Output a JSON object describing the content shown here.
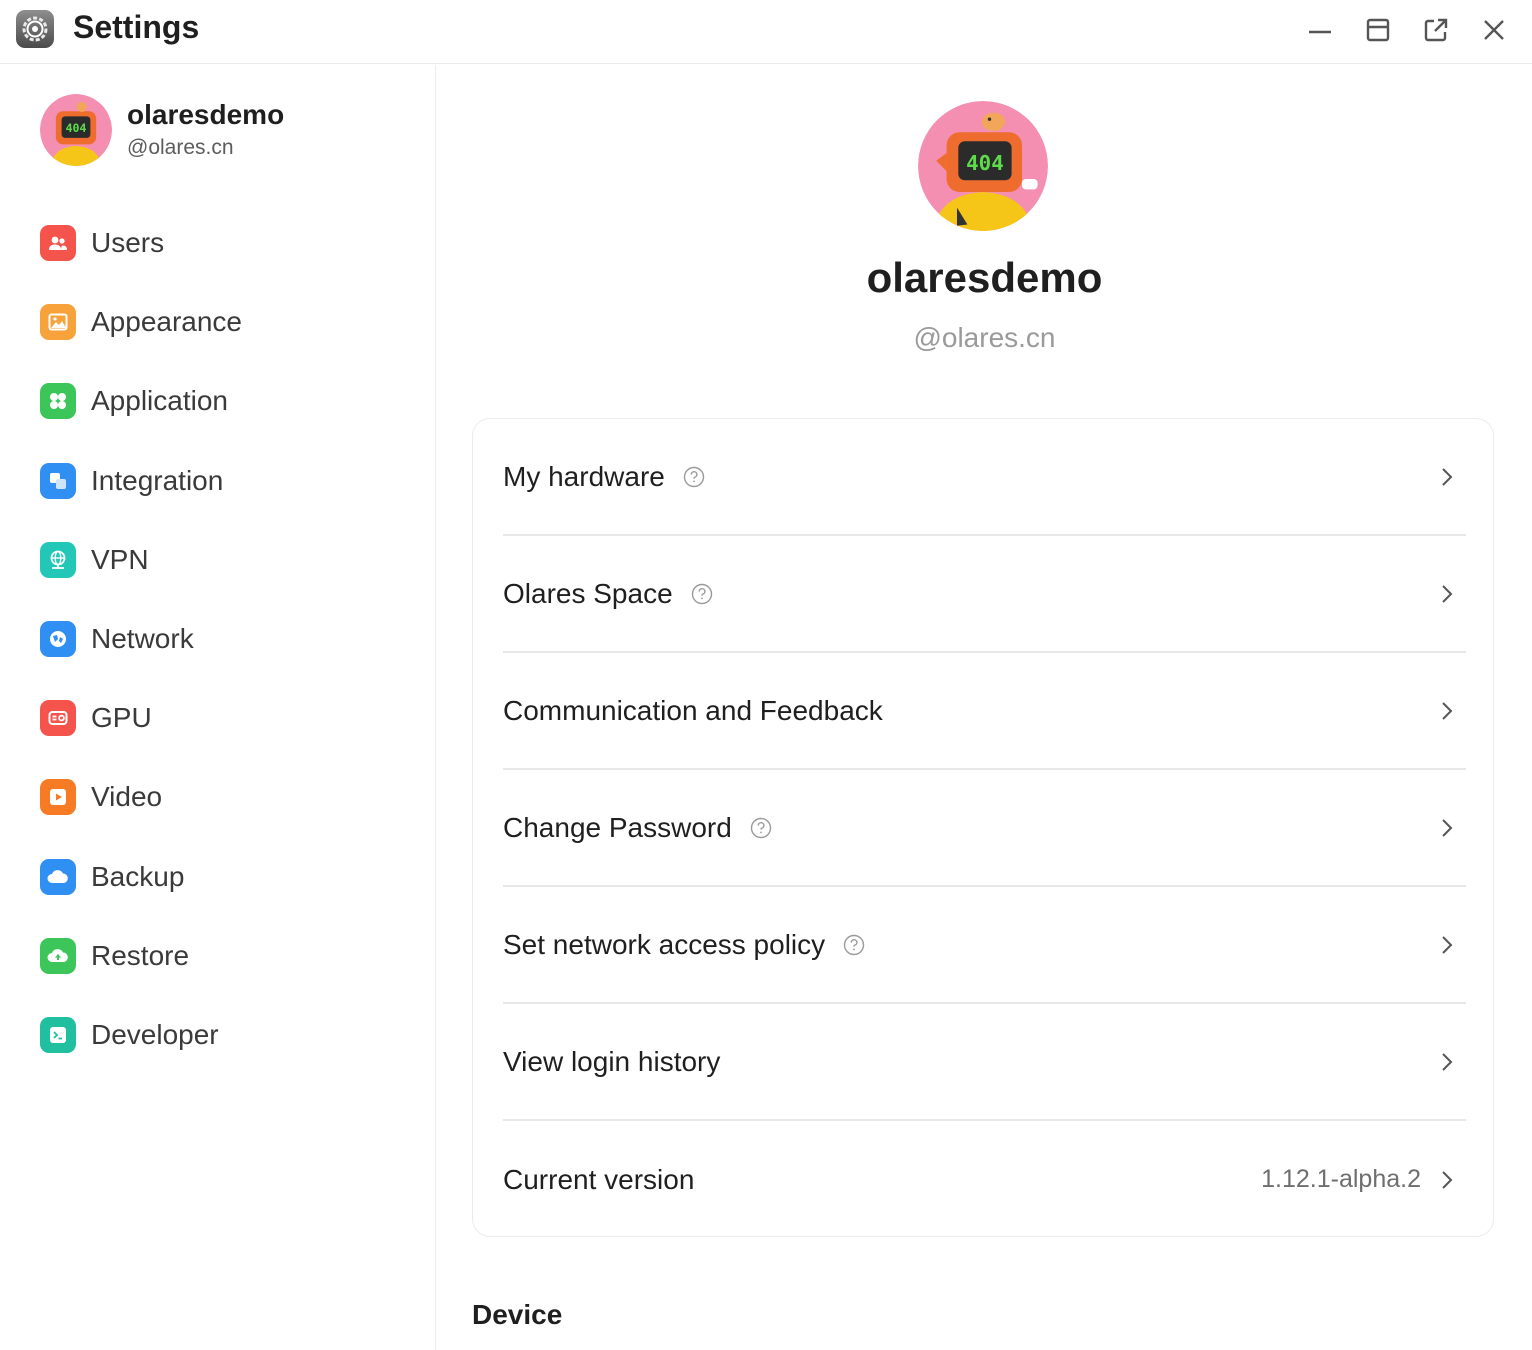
{
  "window": {
    "title": "Settings",
    "icons": [
      "settings-gear-icon",
      "minimize-icon",
      "maximize-icon",
      "open-external-icon",
      "close-icon"
    ]
  },
  "user": {
    "name": "olaresdemo",
    "domain": "@olares.cn",
    "avatar_text": "404"
  },
  "sidebar": {
    "items": [
      {
        "label": "Users",
        "icon": "users-icon",
        "color": "#f5544d"
      },
      {
        "label": "Appearance",
        "icon": "image-icon",
        "color": "#f7a23b"
      },
      {
        "label": "Application",
        "icon": "apps-icon",
        "color": "#3cc65a"
      },
      {
        "label": "Integration",
        "icon": "integration-icon",
        "color": "#2f8ff3"
      },
      {
        "label": "VPN",
        "icon": "globe-icon",
        "color": "#22c7b8"
      },
      {
        "label": "Network",
        "icon": "network-icon",
        "color": "#2f8ff3"
      },
      {
        "label": "GPU",
        "icon": "gpu-icon",
        "color": "#f5544d"
      },
      {
        "label": "Video",
        "icon": "video-icon",
        "color": "#f77a24"
      },
      {
        "label": "Backup",
        "icon": "cloud-icon",
        "color": "#2f8ff3"
      },
      {
        "label": "Restore",
        "icon": "cloud-restore-icon",
        "color": "#3cc65a"
      },
      {
        "label": "Developer",
        "icon": "terminal-icon",
        "color": "#1fbf9f"
      }
    ]
  },
  "rows": [
    {
      "label": "My hardware",
      "help": true,
      "value": ""
    },
    {
      "label": "Olares Space",
      "help": true,
      "value": ""
    },
    {
      "label": "Communication and Feedback",
      "help": false,
      "value": ""
    },
    {
      "label": "Change Password",
      "help": true,
      "value": ""
    },
    {
      "label": "Set network access policy",
      "help": true,
      "value": ""
    },
    {
      "label": "View login history",
      "help": false,
      "value": ""
    },
    {
      "label": "Current version",
      "help": false,
      "value": "1.12.1-alpha.2"
    }
  ],
  "sections": {
    "device_title": "Device"
  }
}
